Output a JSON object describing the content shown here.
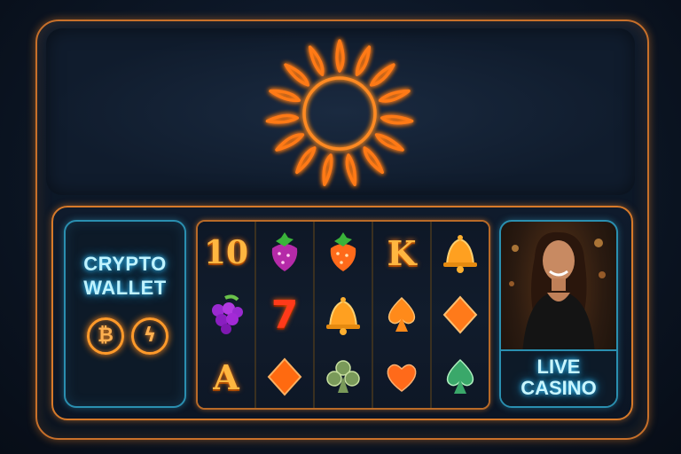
{
  "crypto_wallet": {
    "title_line1": "CRYPTO",
    "title_line2": "WALLET",
    "coins": [
      {
        "icon": "bitcoin-icon",
        "glyph": "₿"
      },
      {
        "icon": "lightning-icon",
        "glyph": "ϟ"
      }
    ]
  },
  "reels": [
    [
      "10",
      "grapes",
      "A"
    ],
    [
      "strawberry",
      "7",
      "diamond"
    ],
    [
      "strawberry",
      "bell",
      "club"
    ],
    [
      "K",
      "spade",
      "heart"
    ],
    [
      "bell",
      "diamond",
      "spade"
    ]
  ],
  "live_casino": {
    "title_line1": "LIVE",
    "title_line2": "CASINO",
    "image": "live-dealer-portrait"
  },
  "colors": {
    "neon_orange": "#ff8a1a",
    "neon_blue": "#35c3ff",
    "frame_orange": "#c8702a"
  }
}
